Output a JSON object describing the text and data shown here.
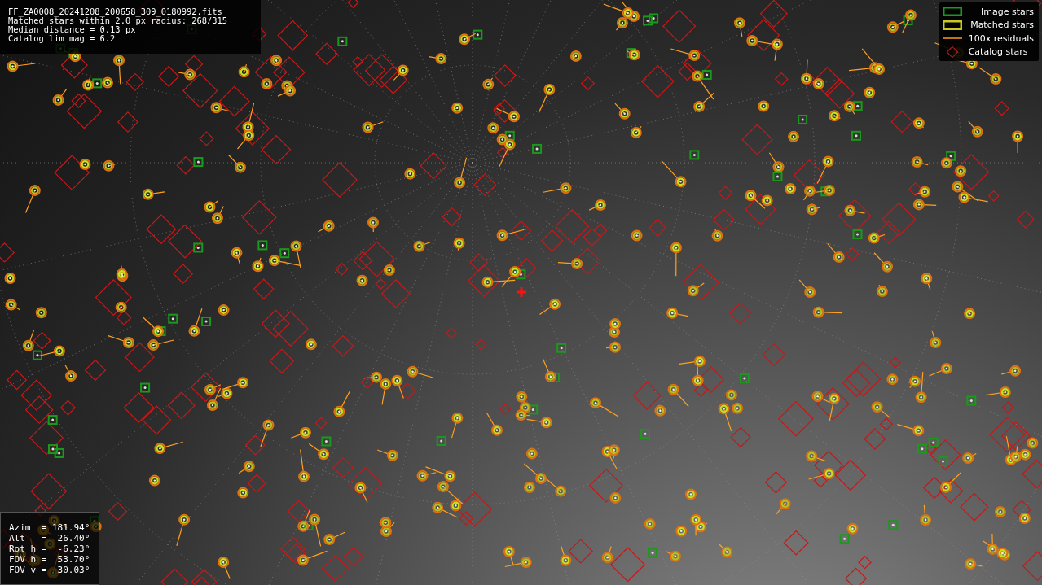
{
  "info_box": {
    "lines": [
      "FF_ZA0008_20241208_200658_309_0180992.fits",
      "Matched stars within 2.0 px radius: 268/315",
      "Median distance = 0.13 px",
      "Catalog lim mag = 6.2"
    ]
  },
  "legend": {
    "items": [
      {
        "kind": "image",
        "label": "Image stars"
      },
      {
        "kind": "matched",
        "label": "Matched stars"
      },
      {
        "kind": "residual",
        "label": "100x residuals"
      },
      {
        "kind": "catalog",
        "label": "Catalog stars"
      }
    ]
  },
  "pointing_box": {
    "lines": [
      "Azim  = 181.94°",
      "Alt   =  26.40°",
      "Rot h =  -6.23°",
      "FOV h =  53.70°",
      "FOV v =  30.03°"
    ]
  }
}
